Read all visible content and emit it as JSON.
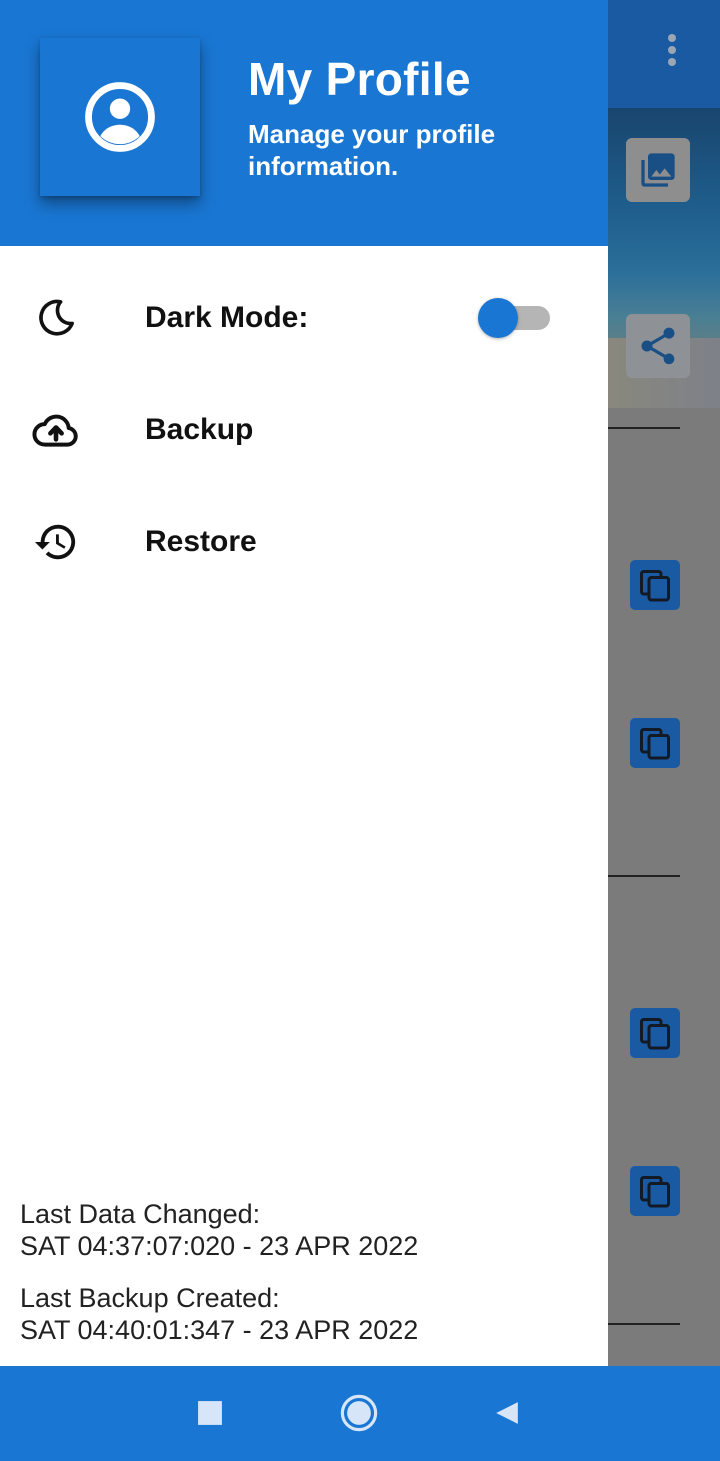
{
  "drawer": {
    "header": {
      "title": "My Profile",
      "subtitle": "Manage your profile information."
    },
    "items": [
      {
        "label": "Dark Mode:",
        "icon": "moon-icon",
        "toggle": {
          "on": false
        }
      },
      {
        "label": "Backup",
        "icon": "cloud-upload-icon"
      },
      {
        "label": "Restore",
        "icon": "history-icon"
      }
    ],
    "info": {
      "last_changed_label": "Last Data Changed:",
      "last_changed_value": "SAT 04:37:07:020 - 23 APR 2022",
      "last_backup_label": "Last Backup Created:",
      "last_backup_value": "SAT 04:40:01:347 - 23 APR 2022"
    }
  },
  "colors": {
    "primary": "#1976d2",
    "scrim_background": "#7b7b7b",
    "text": "#111111"
  },
  "navbar": {
    "icons": [
      "recents-square-icon",
      "home-circle-icon",
      "back-triangle-icon"
    ]
  }
}
